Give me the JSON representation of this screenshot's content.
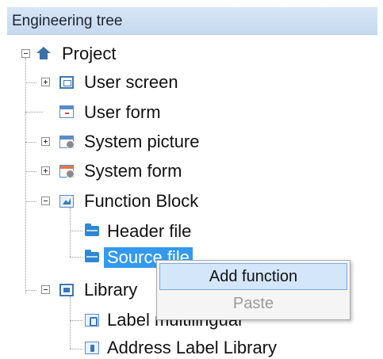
{
  "panel": {
    "title": "Engineering tree"
  },
  "tree": {
    "root": {
      "label": "Project",
      "icon": "home-icon"
    },
    "items": [
      {
        "label": "User screen",
        "icon": "screen-icon",
        "expander": "plus"
      },
      {
        "label": "User form",
        "icon": "form-icon",
        "expander": "none"
      },
      {
        "label": "System picture",
        "icon": "system-picture-icon",
        "expander": "plus"
      },
      {
        "label": "System form",
        "icon": "system-form-icon",
        "expander": "plus"
      },
      {
        "label": "Function Block",
        "icon": "function-block-icon",
        "expander": "minus",
        "children": [
          {
            "label": "Header file",
            "icon": "folder-icon"
          },
          {
            "label": "Source file",
            "icon": "folder-icon",
            "selected": true
          }
        ]
      },
      {
        "label": "Library",
        "icon": "library-icon",
        "expander": "minus",
        "children": [
          {
            "label": "Label multilingual",
            "icon": "label-multilingual-icon"
          },
          {
            "label": "Address Label Library",
            "icon": "address-label-icon"
          }
        ]
      }
    ]
  },
  "context_menu": {
    "items": [
      {
        "label": "Add function",
        "state": "highlighted"
      },
      {
        "label": "Paste",
        "state": "disabled"
      }
    ]
  },
  "colors": {
    "selection": "#3399ee",
    "header": "#c6d9ef",
    "menu_highlight": "#d4e6f9"
  }
}
